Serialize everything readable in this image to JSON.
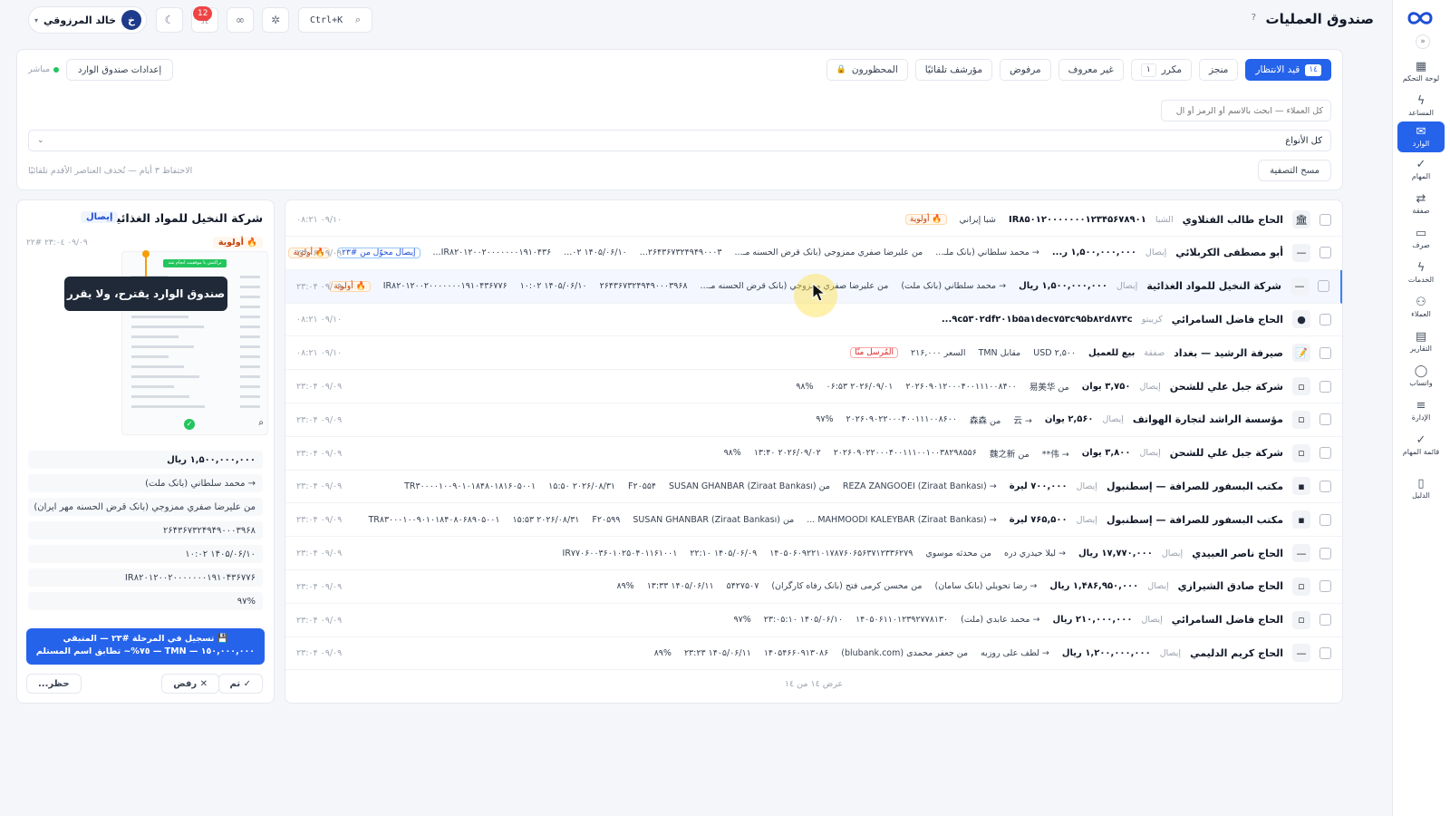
{
  "header": {
    "title": "صندوق العمليات",
    "help": "?",
    "search_shortcut": "Ctrl+K",
    "notif_count": "12",
    "user_name": "خالد المرزوقي",
    "user_initial": "خ"
  },
  "sidebar": {
    "items": [
      {
        "label": "لوحة التحكم",
        "icon": "dashboard-icon",
        "glyph": "▦"
      },
      {
        "label": "المساعد",
        "icon": "bolt-icon",
        "glyph": "ϟ"
      },
      {
        "label": "الوارد",
        "icon": "inbox-icon",
        "glyph": "✉"
      },
      {
        "label": "المهام",
        "icon": "check-icon",
        "glyph": "✓"
      },
      {
        "label": "صفقة",
        "icon": "exchange-icon",
        "glyph": "⇄"
      },
      {
        "label": "صرف",
        "icon": "cash-icon",
        "glyph": "▭"
      },
      {
        "label": "الخدمات",
        "icon": "bolt-icon",
        "glyph": "ϟ"
      },
      {
        "label": "العملاء",
        "icon": "users-icon",
        "glyph": "⚇"
      },
      {
        "label": "التقارير",
        "icon": "report-icon",
        "glyph": "▤"
      },
      {
        "label": "واتساب",
        "icon": "chat-icon",
        "glyph": "◯"
      },
      {
        "label": "الإدارة",
        "icon": "sliders-icon",
        "glyph": "≡"
      },
      {
        "label": "قائمة المهام",
        "icon": "check-icon",
        "glyph": "✓"
      },
      {
        "label": "الدليل",
        "icon": "book-icon",
        "glyph": "▯"
      }
    ]
  },
  "toolbar": {
    "tabs": [
      {
        "label": "قيد الانتظار",
        "count": "١٤"
      },
      {
        "label": "منجز",
        "count": ""
      },
      {
        "label": "مكرر",
        "count": "١"
      },
      {
        "label": "غير معروف",
        "count": ""
      },
      {
        "label": "مرفوض",
        "count": ""
      },
      {
        "label": "مؤرشف تلقائيًا",
        "count": ""
      },
      {
        "label": "المحظورون",
        "count": ""
      }
    ],
    "inbox_settings": "إعدادات صندوق الوارد",
    "live": "مباشر",
    "search_placeholder": "كل العملاء — ابحث بالاسم أو الرمز أو ال",
    "type_select": "كل الأنواع",
    "clear_filter": "مسح التصفية",
    "retention_note": "الاحتفاظ ٣ أيام — تُحذف العناصر الأقدم تلقائيًا"
  },
  "list": {
    "footer": "عرض ١٤ من ١٤",
    "rows": [
      {
        "icon": "🏛",
        "name": "الحاج طالب الفتلاوي",
        "type": "الشبا",
        "fields": [
          "IR۸۵۰۱۲۰۰۰۰۰۰۰۱۲۳۴۵۶۷۸۹۰۱",
          "شبا إيراني"
        ],
        "bold": 0,
        "prio": "🔥 أولوية",
        "extra": "",
        "time": "۰۸:۲۱ ۰۹/۱۰"
      },
      {
        "icon": "—",
        "name": "أبو مصطفى الكربلائي",
        "type": "إيصال",
        "fields": [
          "۱,۵۰۰,۰۰۰,۰۰۰ ر...",
          "→ محمد سلطاني (بانک ملـ...",
          "من عليرضا صفري ممزوجي (بانک قرض الحسنه مـ...",
          "۲۶۴۳۶۷۳۲۴۹۴۹۰۰۰۳...",
          "۱۴۰۵/۰۶/۱۰ ۰۲...",
          "IR۸۲۰۱۲۰۰۲۰۰۰۰۰۰۰۱۹۱۰۴۳۶..."
        ],
        "bold": 0,
        "prio": "🔥 أولوية",
        "extra": "إيصال محوّل من #۲۳",
        "time": "۲۳:۰۶ ۰۹/۰۹"
      },
      {
        "icon": "—",
        "name": "شركة النخيل للمواد الغذائية",
        "type": "إيصال",
        "fields": [
          "۱,۵۰۰,۰۰۰,۰۰۰ ريال",
          "→ محمد سلطاني (بانک ملت)",
          "من عليرضا صفري ممزوجي (بانک قرض الحسنه مـ...",
          "۲۶۴۳۶۷۳۲۴۹۴۹۰۰۰۳۹۶۸",
          "۱۴۰۵/۰۶/۱۰ ۱۰:۰۲",
          "IR۸۲۰۱۲۰۰۲۰۰۰۰۰۰۰۱۹۱۰۴۳۶۷۷۶"
        ],
        "bold": 0,
        "prio": "🔥 أولوية",
        "extra": "",
        "time": "۲۳:۰۴ ۰۹/۰۹"
      },
      {
        "icon": "●",
        "name": "الحاج فاضل السامرائي",
        "type": "كريبتو",
        "fields": [
          "۹c۵۳۰۲df۲۰۱b۵a۱dec۷۵۳c۹۵b۸۲d۸۷۳c..."
        ],
        "bold": 0,
        "prio": "",
        "extra": "",
        "time": "۰۸:۲۱ ۰۹/۱۰"
      },
      {
        "icon": "📝",
        "name": "صيرفة الرشيد — بغداد",
        "type": "صفقة",
        "fields": [
          "بيع للعميل",
          "USD ۲,۵۰۰",
          "مقابل TMN",
          "السعر ۲۱۶,۰۰۰"
        ],
        "bold": 0,
        "prio": "",
        "extra": "المُرسل منّا",
        "time": "۰۸:۲۱ ۰۹/۱۰"
      },
      {
        "icon": "▫",
        "name": "شركة جبل علي للشحن",
        "type": "إيصال",
        "fields": [
          "۳,۷۵۰ يوان",
          "من 易美华",
          "۲۰۲۶۰۹۰۱۲۰۰۰۴۰۰۱۱۱۰۰۸۴۰۰",
          "۲۰۲۶/۰۹/۰۱ ۰۶:۵۳",
          "۹۸%"
        ],
        "bold": 0,
        "prio": "",
        "extra": "",
        "time": "۲۳:۰۴ ۰۹/۰۹"
      },
      {
        "icon": "▫",
        "name": "مؤسسة الراشد لتجارة الهواتف",
        "type": "إيصال",
        "fields": [
          "۲,۵۶۰ يوان",
          "→ 云",
          "من 森森",
          "۲۰۲۶۰۹۰۲۲۰۰۰۴۰۰۱۱۱۰۰۸۶۰۰",
          "۹۷%"
        ],
        "bold": 0,
        "prio": "",
        "extra": "",
        "time": "۲۳:۰۴ ۰۹/۰۹"
      },
      {
        "icon": "▫",
        "name": "شركة جبل علي للشحن",
        "type": "إيصال",
        "fields": [
          "۳,۸۰۰ يوان",
          "→ 伟**",
          "من 魏之新",
          "۲۰۲۶۰۹۰۲۲۰۰۰۴۰۰۱۱۱۰۰۱۰۰۳۸۲۹۸۵۵۶",
          "۲۰۲۶/۰۹/۰۲ ۱۳:۴۰",
          "۹۸%"
        ],
        "bold": 0,
        "prio": "",
        "extra": "",
        "time": "۲۳:۰۴ ۰۹/۰۹"
      },
      {
        "icon": "▪",
        "name": "مكتب البسفور للصرافة — إسطنبول",
        "type": "إيصال",
        "fields": [
          "۷۰۰,۰۰۰ ليرة",
          "→ REZA ZANGOOEI (Ziraat Bankası)",
          "من SUSAN GHANBAR (Ziraat Bankası)",
          "F۲۰۵۵۴",
          "۲۰۲۶/۰۸/۳۱ ۱۵:۵۰",
          "TR۳۰۰۰۰۱۰۰۹۰۱۰۱۸۴۸۰۱۸۱۶۰۵۰۰۱"
        ],
        "bold": 0,
        "prio": "",
        "extra": "",
        "time": "۲۳:۰۴ ۰۹/۰۹"
      },
      {
        "icon": "▪",
        "name": "مكتب البسفور للصرافة — إسطنبول",
        "type": "إيصال",
        "fields": [
          "۷۶۵,۵۰۰ ليرة",
          "→ MAHMOODI KALEYBAR (Ziraat Bankası) ...",
          "من SUSAN GHANBAR (Ziraat Bankası)",
          "F۲۰۵۹۹",
          "۲۰۲۶/۰۸/۳۱ ۱۵:۵۳",
          "TR۸۳۰۰۰۱۰۰۹۰۱۰۱۸۴۰۸۰۶۸۹۰۵۰۰۱"
        ],
        "bold": 0,
        "prio": "",
        "extra": "",
        "time": "۲۳:۰۴ ۰۹/۰۹"
      },
      {
        "icon": "—",
        "name": "الحاج ناصر العبيدي",
        "type": "إيصال",
        "fields": [
          "۱۷,۷۷۰,۰۰۰ ريال",
          "→ ليلا حيدري دره",
          "من محدثه موسوي",
          "۱۴۰۵۰۶۰۹۲۲۱۰۱۷۸۷۶۰۶۵۶۳۷۱۲۳۳۶۲۷۹",
          "۱۴۰۵/۰۶/۰۹ ۲۲:۱۰",
          "IR۷۷۰۶۰۰۳۶۰۱۰۲۵۰۴۰۱۱۶۱۰۰۱"
        ],
        "bold": 0,
        "prio": "",
        "extra": "",
        "time": "۲۳:۰۴ ۰۹/۰۹"
      },
      {
        "icon": "▫",
        "name": "الحاج صادق الشيرازي",
        "type": "إيصال",
        "fields": [
          "۱,۴۸۶,۹۵۰,۰۰۰ ريال",
          "→ رضا تحويلي (بانک سامان)",
          "من محسن کرمی فتح (بانک رفاه کارگران)",
          "۵۴۲۷۵۰۷",
          "۱۴۰۵/۰۶/۱۱ ۱۳:۳۳",
          "۸۹%"
        ],
        "bold": 0,
        "prio": "",
        "extra": "",
        "time": "۲۳:۰۴ ۰۹/۰۹"
      },
      {
        "icon": "▫",
        "name": "الحاج فاضل السامرائي",
        "type": "إيصال",
        "fields": [
          "۲۱۰,۰۰۰,۰۰۰ ريال",
          "→ محمد عابدي (ملت)",
          "۱۴۰۵۰۶۱۱۰۱۲۳۹۲۷۷۸۱۳۰",
          "۱۴۰۵/۰۶/۱۰ ۲۳:۰۵:۱۰",
          "۹۷%"
        ],
        "bold": 0,
        "prio": "",
        "extra": "",
        "time": "۲۳:۰۴ ۰۹/۰۹"
      },
      {
        "icon": "—",
        "name": "الحاج كريم الدليمي",
        "type": "إيصال",
        "fields": [
          "۱,۲۰۰,۰۰۰,۰۰۰ ريال",
          "→ لطف على روزبه",
          "من جعفر محمدی (blubank.com)",
          "۱۴۰۵۴۶۶۰۹۱۳۰۸۶",
          "۱۴۰۵/۰۶/۱۱ ۲۳:۲۳",
          "۸۹%"
        ],
        "bold": 0,
        "prio": "",
        "extra": "",
        "time": "۲۳:۰۴ ۰۹/۰۹"
      }
    ]
  },
  "detail": {
    "title": "شركة النخيل للمواد الغذائية",
    "type_badge": "إيصال",
    "priority": "🔥 أولوية",
    "meta": "٠٩/٠٩ ٢٣:٠٤ #٢٢",
    "tooltip": "صندوق الوارد يقترح، ولا يقرر",
    "receipt_banner": "تراکنش با موفقیت انجام شد",
    "lines": [
      "۱,۵۰۰,۰۰۰,۰۰۰ ريال",
      "→ محمد سلطاني (بانک ملت)",
      "من عليرضا صفري ممزوجي (بانک قرض الحسنه مهر ايران)",
      "۲۶۴۳۶۷۳۲۴۹۴۹۰۰۰۳۹۶۸",
      "۱۴۰۵/۰۶/۱۰ ۱۰:۰۲",
      "IR۸۲۰۱۲۰۰۲۰۰۰۰۰۰۰۱۹۱۰۴۳۶۷۷۶",
      "۹۷%"
    ],
    "action_banner": "💾 تسجيل في المرحلة #٢٣ — المتبقي ١٥٠,٠٠٠,٠٠٠ — TMN — ٧٥%~ تطابق اسم المستلم",
    "done_button": "✓ تم",
    "reject_button": "✕ رفض",
    "block_button": "حظر..."
  },
  "colors": {
    "accent": "#2563eb",
    "priority": "#ea580c",
    "live": "#22c55e"
  }
}
